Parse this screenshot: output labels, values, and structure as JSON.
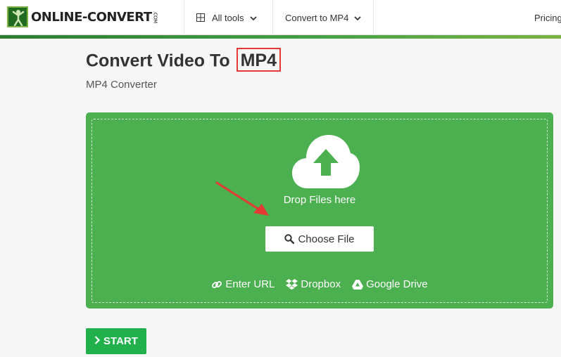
{
  "header": {
    "logo_text": "ONLINE-CONVERT",
    "logo_suffix": ".COM",
    "nav": {
      "all_tools": "All tools",
      "convert_to": "Convert to MP4",
      "pricing": "Pricing"
    }
  },
  "main": {
    "title_prefix": "Convert Video To",
    "title_highlight": "MP4",
    "subtitle": "MP4 Converter",
    "dropzone": {
      "drop_text": "Drop Files here",
      "choose_file": "Choose File",
      "sources": {
        "url": "Enter URL",
        "dropbox": "Dropbox",
        "gdrive": "Google Drive"
      }
    },
    "start_label": "START"
  },
  "colors": {
    "accent_green": "#4caf50",
    "start_green": "#21b04b",
    "highlight_red": "#e53935"
  },
  "icons": [
    "grid-icon",
    "chevron-down-icon",
    "cloud-upload-icon",
    "search-icon",
    "link-icon",
    "dropbox-icon",
    "google-drive-icon",
    "chevron-right-icon",
    "red-arrow-annotation"
  ]
}
